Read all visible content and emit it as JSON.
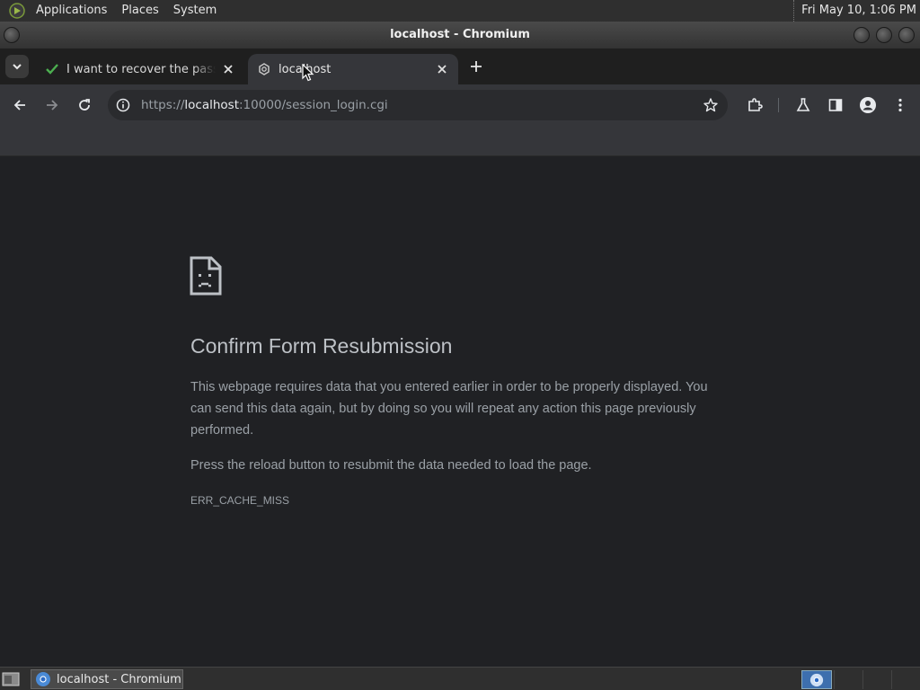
{
  "panel": {
    "menus": [
      "Applications",
      "Places",
      "System"
    ],
    "clock": "Fri May 10,  1:06 PM"
  },
  "window": {
    "title": "localhost - Chromium"
  },
  "tabs": [
    {
      "label": "I want to recover the password",
      "icon": "checkmark-icon",
      "active": false
    },
    {
      "label": "localhost",
      "icon": "webmin-icon",
      "active": true
    }
  ],
  "toolbar": {
    "url_prefix": "https://",
    "url_host": "localhost",
    "url_rest": ":10000/session_login.cgi"
  },
  "error_page": {
    "icon": "sad-page-icon",
    "title": "Confirm Form Resubmission",
    "paragraph1": "This webpage requires data that you entered earlier in order to be properly displayed. You can send this data again, but by doing so you will repeat any action this page previously performed.",
    "paragraph2": "Press the reload button to resubmit the data needed to load the page.",
    "error_code": "ERR_CACHE_MISS"
  },
  "taskbar": {
    "task_label": "localhost - Chromium"
  },
  "colors": {
    "page_background": "#202124",
    "toolbar": "#35363a",
    "title_text": "#bdc1c6",
    "body_text": "#9aa0a6"
  }
}
